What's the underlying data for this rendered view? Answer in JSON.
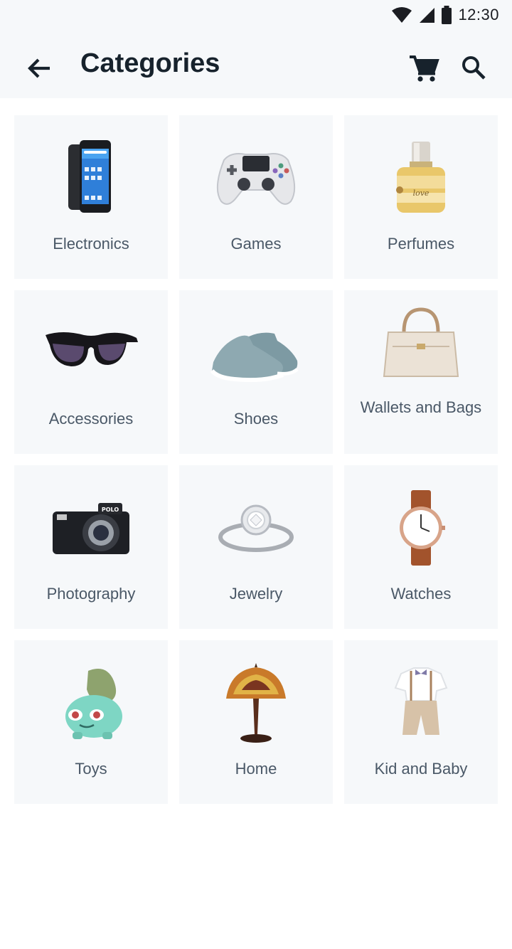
{
  "status_bar": {
    "time": "12:30"
  },
  "header": {
    "title": "Categories"
  },
  "categories": [
    {
      "label": "Electronics",
      "icon": "phone-icon"
    },
    {
      "label": "Games",
      "icon": "gamepad-icon"
    },
    {
      "label": "Perfumes",
      "icon": "perfume-icon"
    },
    {
      "label": "Accessories",
      "icon": "sunglasses-icon"
    },
    {
      "label": "Shoes",
      "icon": "shoe-icon"
    },
    {
      "label": "Wallets and Bags",
      "icon": "handbag-icon"
    },
    {
      "label": "Photography",
      "icon": "camera-icon"
    },
    {
      "label": "Jewelry",
      "icon": "ring-icon"
    },
    {
      "label": "Watches",
      "icon": "watch-icon"
    },
    {
      "label": "Toys",
      "icon": "toy-icon"
    },
    {
      "label": "Home",
      "icon": "lamp-icon"
    },
    {
      "label": "Kid and Baby",
      "icon": "kids-outfit-icon"
    }
  ]
}
